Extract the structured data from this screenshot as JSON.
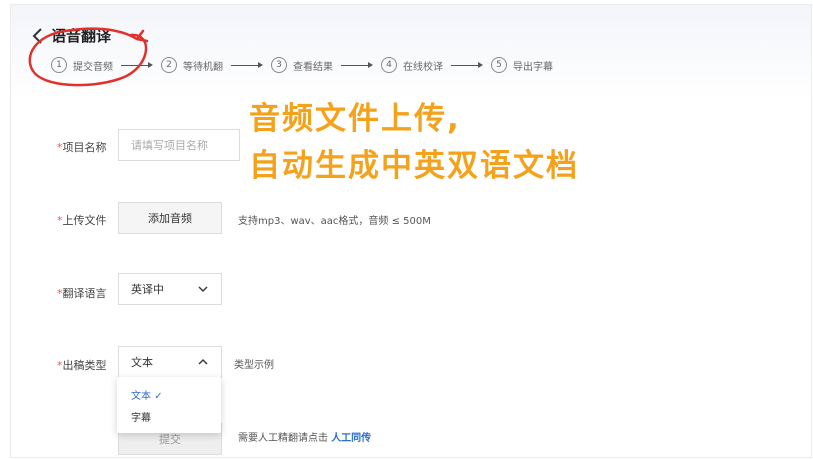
{
  "header": {
    "title": "语音翻译"
  },
  "steps": [
    {
      "num": "1",
      "label": "提交音频"
    },
    {
      "num": "2",
      "label": "等待机翻"
    },
    {
      "num": "3",
      "label": "查看结果"
    },
    {
      "num": "4",
      "label": "在线校译"
    },
    {
      "num": "5",
      "label": "导出字幕"
    }
  ],
  "overlay": {
    "line1": "音频文件上传,",
    "line2": "自动生成中英双语文档",
    "color": "#f4a21b"
  },
  "form": {
    "project": {
      "label": "项目名称",
      "placeholder": "请填写项目名称"
    },
    "upload": {
      "label": "上传文件",
      "button": "添加音频",
      "hint": "支持mp3、wav、aac格式，音频 ≤ 500M"
    },
    "language": {
      "label": "翻译语言",
      "value": "英译中"
    },
    "output": {
      "label": "出稿类型",
      "value": "文本",
      "example": "类型示例",
      "options": [
        "文本",
        "字幕"
      ],
      "selected_mark": "✓"
    },
    "submit": {
      "label": "提交",
      "hint_prefix": "需要人工精翻请点击",
      "link": "人工同传"
    }
  },
  "required_mark": "*",
  "colors": {
    "accent": "#2b6ed2",
    "annotation": "#e0322c"
  }
}
